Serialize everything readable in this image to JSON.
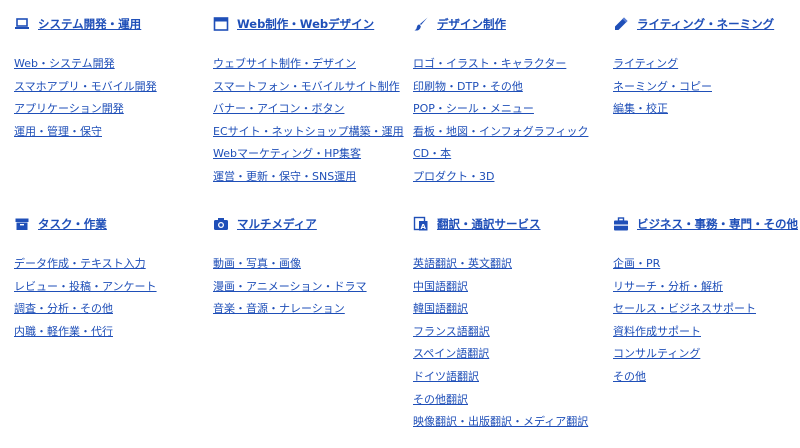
{
  "colors": {
    "link": "#1f4fb8",
    "background": "#ffffff"
  },
  "sections": [
    {
      "title": "システム開発・運用",
      "icon": "laptop-icon",
      "links": [
        "Web・システム開発",
        "スマホアプリ・モバイル開発",
        "アプリケーション開発",
        "運用・管理・保守"
      ]
    },
    {
      "title": "Web制作・Webデザイン",
      "icon": "browser-window-icon",
      "links": [
        "ウェブサイト制作・デザイン",
        "スマートフォン・モバイルサイト制作",
        "バナー・アイコン・ボタン",
        "ECサイト・ネットショップ構築・運用",
        "Webマーケティング・HP集客",
        "運営・更新・保守・SNS運用"
      ]
    },
    {
      "title": "デザイン制作",
      "icon": "paintbrush-icon",
      "links": [
        "ロゴ・イラスト・キャラクター",
        "印刷物・DTP・その他",
        "POP・シール・メニュー",
        "看板・地図・インフォグラフィック",
        "CD・本",
        "プロダクト・3D"
      ]
    },
    {
      "title": "ライティング・ネーミング",
      "icon": "pencil-icon",
      "links": [
        "ライティング",
        "ネーミング・コピー",
        "編集・校正"
      ]
    },
    {
      "title": "タスク・作業",
      "icon": "archive-box-icon",
      "links": [
        "データ作成・テキスト入力",
        "レビュー・投稿・アンケート",
        "調査・分析・その他",
        "内職・軽作業・代行"
      ]
    },
    {
      "title": "マルチメディア",
      "icon": "camera-icon",
      "links": [
        "動画・写真・画像",
        "漫画・アニメーション・ドラマ",
        "音楽・音源・ナレーション"
      ]
    },
    {
      "title": "翻訳・通訳サービス",
      "icon": "translate-book-icon",
      "links": [
        "英語翻訳・英文翻訳",
        "中国語翻訳",
        "韓国語翻訳",
        "フランス語翻訳",
        "スペイン語翻訳",
        "ドイツ語翻訳",
        "その他翻訳",
        "映像翻訳・出版翻訳・メディア翻訳"
      ]
    },
    {
      "title": "ビジネス・事務・専門・その他",
      "icon": "briefcase-icon",
      "links": [
        "企画・PR",
        "リサーチ・分析・解析",
        "セールス・ビジネスサポート",
        "資料作成サポート",
        "コンサルティング",
        "その他"
      ]
    }
  ]
}
